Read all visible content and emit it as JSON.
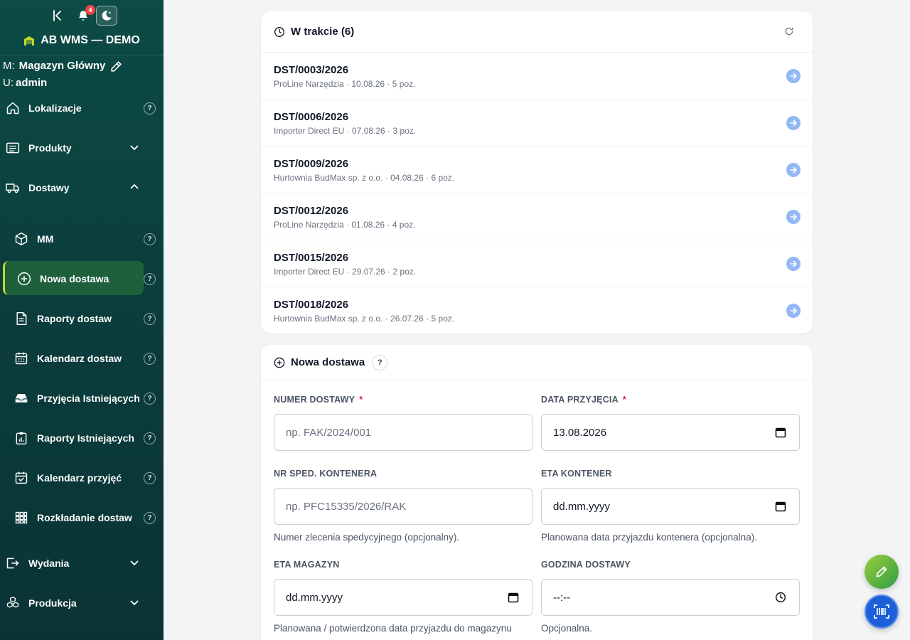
{
  "header": {
    "notification_count": "4",
    "brand": "AB WMS — DEMO",
    "warehouse_prefix": "M:",
    "warehouse": "Magazyn Główny",
    "user_prefix": "U:",
    "user": "admin"
  },
  "nav": {
    "lokalizacje": "Lokalizacje",
    "produkty": "Produkty",
    "dostawy": "Dostawy",
    "mm": "MM",
    "nowa_dostawa": "Nowa dostawa",
    "raporty_dostaw": "Raporty dostaw",
    "kalendarz_dostaw": "Kalendarz dostaw",
    "przyjecia": "Przyjęcia Istniejących",
    "raporty_istn": "Raporty Istniejących",
    "kalendarz_przyjec": "Kalendarz przyjęć",
    "rozkladanie": "Rozkładanie dostaw",
    "wydania": "Wydania",
    "produkcja": "Produkcja",
    "help": "?"
  },
  "in_progress": {
    "title": "W trakcie (6)",
    "items": [
      {
        "title": "DST/0003/2026",
        "sub": "ProLine Narzędzia · 10.08.26 · 5 poz."
      },
      {
        "title": "DST/0006/2026",
        "sub": "Importer Direct EU · 07.08.26 · 3 poz."
      },
      {
        "title": "DST/0009/2026",
        "sub": "Hurtownia BudMax sp. z o.o. · 04.08.26 · 6 poz."
      },
      {
        "title": "DST/0012/2026",
        "sub": "ProLine Narzędzia · 01.08.26 · 4 poz."
      },
      {
        "title": "DST/0015/2026",
        "sub": "Importer Direct EU · 29.07.26 · 2 poz."
      },
      {
        "title": "DST/0018/2026",
        "sub": "Hurtownia BudMax sp. z o.o. · 26.07.26 · 5 poz."
      }
    ]
  },
  "new_delivery": {
    "title": "Nowa dostawa",
    "help": "?",
    "required_mark": "*",
    "numer_label": "NUMER DOSTAWY",
    "numer_placeholder": "np. FAK/2024/001",
    "data_label": "DATA PRZYJĘCIA",
    "data_value": "13.08.2026",
    "spedycja_label": "NR SPED. KONTENERA",
    "spedycja_placeholder": "np. PFC15335/2026/RAK",
    "spedycja_help": "Numer zlecenia spedycyjnego (opcjonalny).",
    "eta_kontener_label": "ETA KONTENER",
    "eta_kontener_value": "dd.mm.yyyy",
    "eta_kontener_help": "Planowana data przyjazdu kontenera (opcjonalna).",
    "eta_magazyn_label": "ETA MAGAZYN",
    "eta_magazyn_value": "dd.mm.yyyy",
    "eta_magazyn_help": "Planowana / potwierdzona data przyjazdu do magazynu",
    "godzina_label": "GODZINA DOSTAWY",
    "godzina_value": "--:--",
    "godzina_help": "Opcjonalna."
  },
  "colors": {
    "sidebar": "#0d4b45",
    "active": "#1e5f3c",
    "accent_blue": "#1d5fd8"
  }
}
